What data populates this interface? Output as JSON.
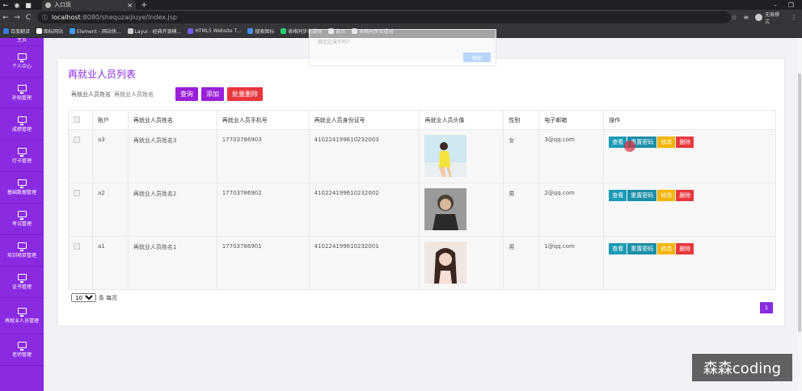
{
  "browser": {
    "tab_title": "入口页",
    "address_host": "localhost",
    "address_path": ":8080/shequzaijiuye/index.jsp",
    "incognito_label": "无痕模式",
    "bookmarks": [
      {
        "label": "百度翻译",
        "color": "#3a7bd5"
      },
      {
        "label": "图标网站",
        "color": "#ffffff"
      },
      {
        "label": "Element - 网站快...",
        "color": "#409eff"
      },
      {
        "label": "Layui - 经典开源模...",
        "color": "#cccccc"
      },
      {
        "label": "HTML5 Website T...",
        "color": "#6c5ce7"
      },
      {
        "label": "搜索图标",
        "color": "#4a90e2"
      },
      {
        "label": "表格同步名规则",
        "color": "#2ecc71"
      },
      {
        "label": "首页",
        "color": "#cccccc"
      },
      {
        "label": "表格同步名规则",
        "color": "#cccccc"
      }
    ]
  },
  "sidebar": {
    "top_label": "主页",
    "items": [
      {
        "label": "个人中心"
      },
      {
        "label": "补贴管理"
      },
      {
        "label": "成绩管理"
      },
      {
        "label": "打卡管理"
      },
      {
        "label": "基础数据管理"
      },
      {
        "label": "考试管理"
      },
      {
        "label": "培训项目管理"
      },
      {
        "label": "证书管理"
      },
      {
        "label": "再就业人员管理"
      },
      {
        "label": "老师管理"
      }
    ]
  },
  "main": {
    "title": "再就业人员列表",
    "search": {
      "label": "再就业人员姓名",
      "placeholder": "再就业人员姓名",
      "query_button": "查询",
      "add_button": "添加",
      "batch_delete_button": "批量删除"
    },
    "table": {
      "headers": [
        "",
        "账户",
        "再就业人员姓名",
        "再就业人员手机号",
        "再就业人员身份证号",
        "再就业人员头像",
        "性别",
        "电子邮箱",
        "操作"
      ],
      "rows": [
        {
          "account": "a3",
          "name": "再就业人员姓名3",
          "phone": "17703786903",
          "id_card": "410224199610232003",
          "gender": "女",
          "email": "3@qq.com"
        },
        {
          "account": "a2",
          "name": "再就业人员姓名2",
          "phone": "17703786902",
          "id_card": "410224199610232002",
          "gender": "男",
          "email": "2@qq.com"
        },
        {
          "account": "a1",
          "name": "再就业人员姓名1",
          "phone": "17703786901",
          "id_card": "410224199610232001",
          "gender": "男",
          "email": "1@qq.com"
        }
      ],
      "actions": {
        "view": "查看",
        "reset": "重置密码",
        "edit": "修改",
        "delete": "删除"
      }
    },
    "pagination": {
      "page_size": "10",
      "per_page_label": "条 每页",
      "current_page": "1"
    }
  },
  "overlay": {
    "text": "确定此操作吗？",
    "button": "确定"
  },
  "watermark": "森森coding"
}
